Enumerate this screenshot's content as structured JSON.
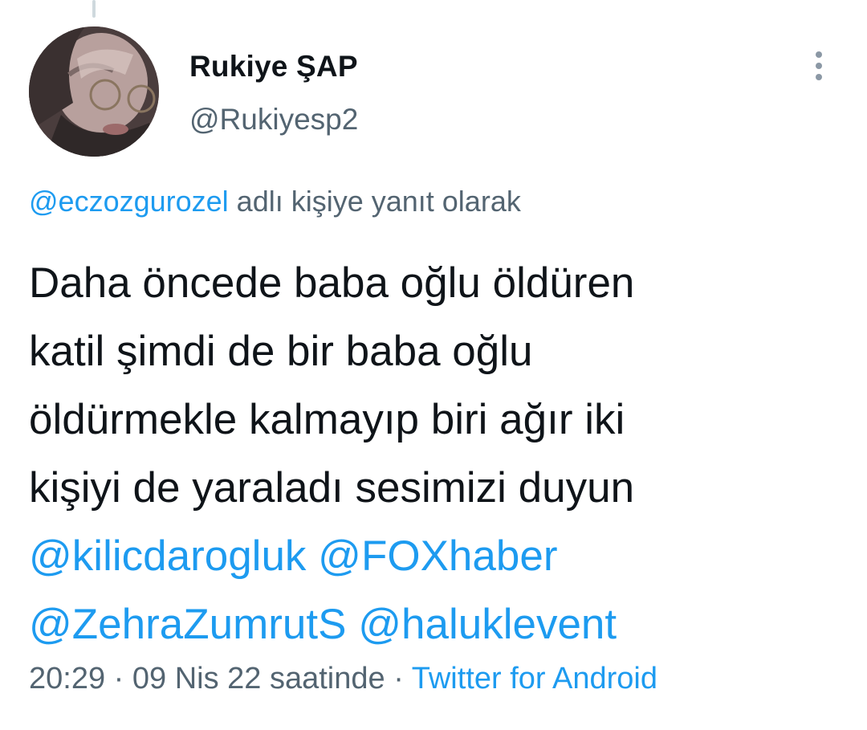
{
  "user": {
    "display_name": "Rukiye ŞAP",
    "handle": "@Rukiyesp2"
  },
  "reply_context": {
    "mention": "@eczozgurozel",
    "suffix": " adlı kişiye yanıt olarak"
  },
  "tweet": {
    "lines": [
      "Daha öncede baba oğlu öldüren",
      "katil şimdi de bir baba oğlu",
      "öldürmekle kalmayıp biri ağır iki",
      "kişiyi de yaraladı sesimizi duyun"
    ],
    "mentions": [
      "@kilicdarogluk",
      "@FOXhaber",
      "@ZehraZumrutS",
      "@haluklevent"
    ]
  },
  "meta": {
    "time": "20:29",
    "separator": " · ",
    "date": "09 Nis 22 saatinde",
    "source": "Twitter for Android"
  },
  "colors": {
    "link": "#1d9bf0",
    "secondary_text": "#536471",
    "primary_text": "#0f1419"
  },
  "icons": {
    "more": "vertical-ellipsis-icon"
  }
}
